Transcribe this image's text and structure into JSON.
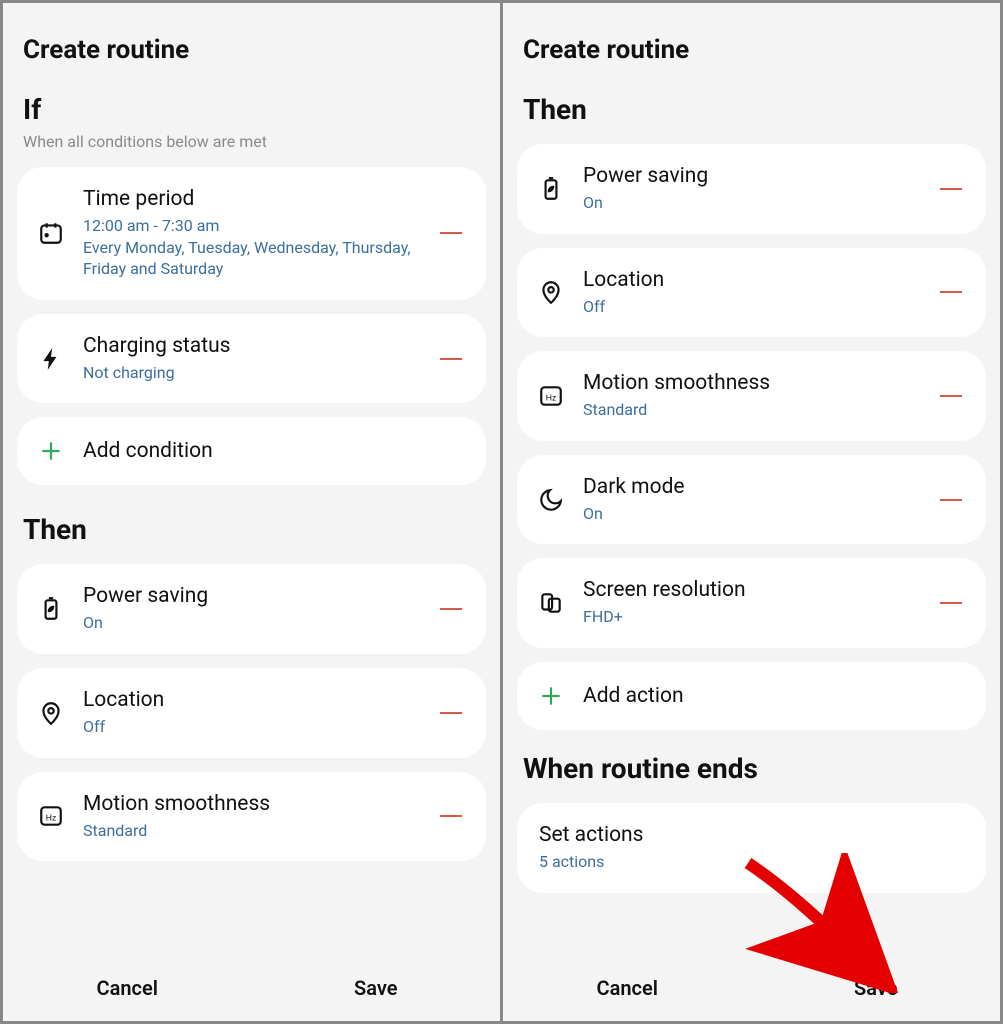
{
  "left": {
    "title": "Create routine",
    "if_label": "If",
    "if_sub": "When all conditions below are met",
    "conditions": [
      {
        "title": "Time period",
        "value": "12:00  am - 7:30  am\nEvery Monday, Tuesday, Wednesday, Thursday, Friday and Saturday"
      },
      {
        "title": "Charging status",
        "value": "Not charging"
      }
    ],
    "add_condition": "Add condition",
    "then_label": "Then",
    "actions": [
      {
        "title": "Power saving",
        "value": "On"
      },
      {
        "title": "Location",
        "value": "Off"
      },
      {
        "title": "Motion smoothness",
        "value": "Standard"
      }
    ],
    "cancel": "Cancel",
    "save": "Save"
  },
  "right": {
    "title": "Create routine",
    "then_label": "Then",
    "actions": [
      {
        "title": "Power saving",
        "value": "On"
      },
      {
        "title": "Location",
        "value": "Off"
      },
      {
        "title": "Motion smoothness",
        "value": "Standard"
      },
      {
        "title": "Dark mode",
        "value": "On"
      },
      {
        "title": "Screen resolution",
        "value": "FHD+"
      }
    ],
    "add_action": "Add action",
    "ends_label": "When routine ends",
    "set_actions_title": "Set actions",
    "set_actions_value": "5 actions",
    "cancel": "Cancel",
    "save": "Save"
  }
}
